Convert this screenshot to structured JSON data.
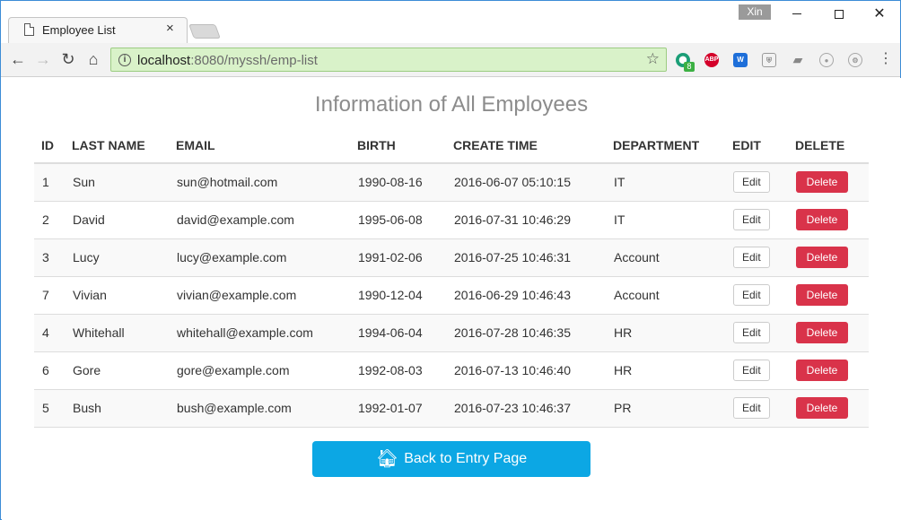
{
  "browser": {
    "tab_title": "Employee List",
    "tab_close": "×",
    "user": "Xin",
    "url_host": "localhost",
    "url_rest": ":8080/myssh/emp-list",
    "ext_badge": "8",
    "ext_abp": "ABP",
    "ext_w": "W",
    "icons": {
      "back": "arrow-left-icon",
      "forward": "arrow-right-icon",
      "reload": "reload-icon",
      "home": "home-icon",
      "info": "info-icon",
      "bookmark": "star-icon",
      "menu": "menu-dots-icon"
    }
  },
  "page": {
    "title": "Information of All Employees",
    "back_button": "Back to Entry Page"
  },
  "table": {
    "headers": {
      "id": "ID",
      "last_name": "LAST NAME",
      "email": "EMAIL",
      "birth": "BIRTH",
      "create_time": "CREATE TIME",
      "department": "DEPARTMENT",
      "edit": "EDIT",
      "delete": "DELETE"
    },
    "edit_label": "Edit",
    "delete_label": "Delete",
    "rows": [
      {
        "id": "1",
        "last_name": "Sun",
        "email": "sun@hotmail.com",
        "birth": "1990-08-16",
        "create_time": "2016-06-07 05:10:15",
        "department": "IT"
      },
      {
        "id": "2",
        "last_name": "David",
        "email": "david@example.com",
        "birth": "1995-06-08",
        "create_time": "2016-07-31 10:46:29",
        "department": "IT"
      },
      {
        "id": "3",
        "last_name": "Lucy",
        "email": "lucy@example.com",
        "birth": "1991-02-06",
        "create_time": "2016-07-25 10:46:31",
        "department": "Account"
      },
      {
        "id": "7",
        "last_name": "Vivian",
        "email": "vivian@example.com",
        "birth": "1990-12-04",
        "create_time": "2016-06-29 10:46:43",
        "department": "Account"
      },
      {
        "id": "4",
        "last_name": "Whitehall",
        "email": "whitehall@example.com",
        "birth": "1994-06-04",
        "create_time": "2016-07-28 10:46:35",
        "department": "HR"
      },
      {
        "id": "6",
        "last_name": "Gore",
        "email": "gore@example.com",
        "birth": "1992-08-03",
        "create_time": "2016-07-13 10:46:40",
        "department": "HR"
      },
      {
        "id": "5",
        "last_name": "Bush",
        "email": "bush@example.com",
        "birth": "1992-01-07",
        "create_time": "2016-07-23 10:46:37",
        "department": "PR"
      }
    ]
  },
  "colors": {
    "delete": "#d9334a",
    "primary": "#0ca7e4",
    "omnibox": "#d9f2c9"
  }
}
